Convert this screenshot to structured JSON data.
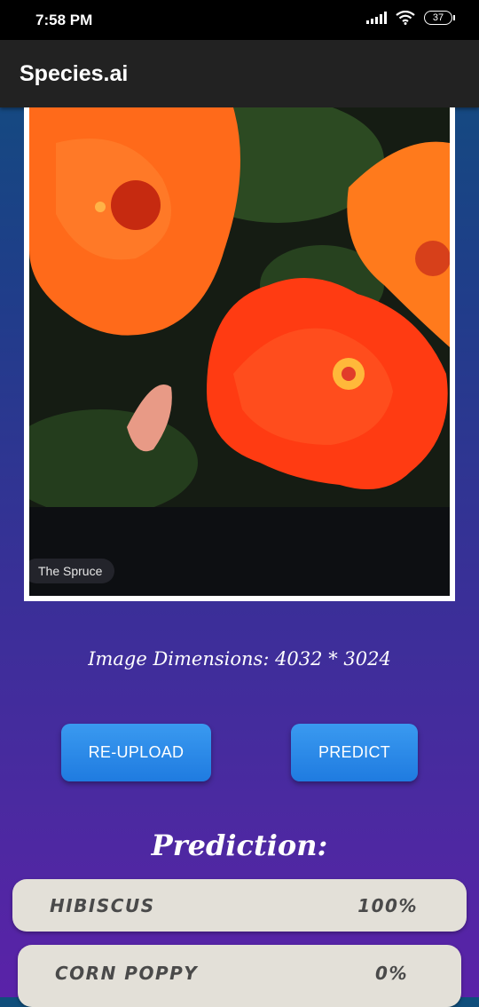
{
  "status_bar": {
    "time": "7:58 PM",
    "battery": "37",
    "icons": [
      "signal-icon",
      "wifi-icon",
      "battery-icon"
    ]
  },
  "app": {
    "title": "Species.ai"
  },
  "image": {
    "watermark": "The Spruce",
    "dimensions_text": "Image Dimensions: 4032 * 3024"
  },
  "buttons": {
    "reupload": "RE-UPLOAD",
    "predict": "PREDICT"
  },
  "prediction": {
    "title": "Prediction:",
    "results": [
      {
        "name": "HIBISCUS",
        "confidence": "100%"
      },
      {
        "name": "CORN POPPY",
        "confidence": "0%"
      }
    ]
  },
  "colors": {
    "button": "#2a8ae8",
    "appbar": "#222222",
    "result_bg": "#e3e0d8"
  }
}
